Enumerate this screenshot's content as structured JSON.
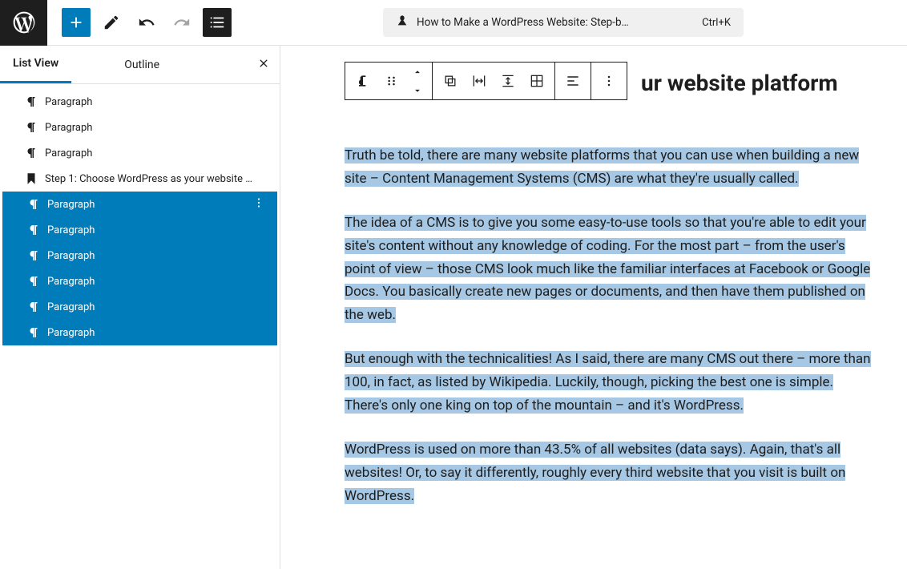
{
  "header": {
    "title": "How to Make a WordPress Website: Step-b…",
    "shortcut": "Ctrl+K"
  },
  "sidebar": {
    "tabs": {
      "list_view": "List View",
      "outline": "Outline"
    },
    "items": [
      {
        "icon": "paragraph",
        "label": "Paragraph",
        "selected": false
      },
      {
        "icon": "paragraph",
        "label": "Paragraph",
        "selected": false
      },
      {
        "icon": "paragraph",
        "label": "Paragraph",
        "selected": false
      },
      {
        "icon": "heading",
        "label": "Step 1: Choose WordPress as your website …",
        "selected": false
      },
      {
        "icon": "paragraph",
        "label": "Paragraph",
        "selected": true,
        "more": true
      },
      {
        "icon": "paragraph",
        "label": "Paragraph",
        "selected": true
      },
      {
        "icon": "paragraph",
        "label": "Paragraph",
        "selected": true
      },
      {
        "icon": "paragraph",
        "label": "Paragraph",
        "selected": true
      },
      {
        "icon": "paragraph",
        "label": "Paragraph",
        "selected": true
      },
      {
        "icon": "paragraph",
        "label": "Paragraph",
        "selected": true
      }
    ]
  },
  "content": {
    "heading": "ur website platform",
    "paragraphs": [
      "Truth be told, there are many website platforms that you can use when building a new site – Content Management Systems (CMS) are what they're usually called.",
      "The idea of a CMS is to give you some easy-to-use tools so that you're able to edit your site's content without any knowledge of coding. For the most part – from the user's point of view – those CMS look much like the familiar interfaces at Facebook or Google Docs. You basically create new pages or documents, and then have them published on the web.",
      "But enough with the technicalities! As I said, there are many CMS out there – more than 100, in fact, as listed by Wikipedia. Luckily, though, picking the best one is simple. There's only one king on top of the mountain – and it's WordPress.",
      "WordPress is used on more than 43.5% of all websites (data says). Again, that's all websites! Or, to say it differently, roughly every third website that you visit is built on WordPress."
    ]
  }
}
